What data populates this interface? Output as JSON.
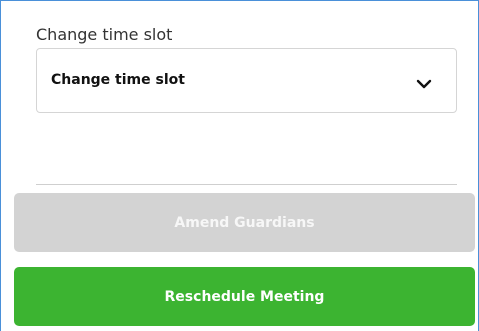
{
  "time_slot": {
    "label": "Change time slot",
    "selected_value": "Change time slot"
  },
  "actions": {
    "amend_label": "Amend Guardians",
    "amend_state": "disabled",
    "reschedule_label": "Reschedule Meeting"
  },
  "colors": {
    "frame_border": "#4a90d9",
    "disabled_button": "#d3d3d3",
    "primary_button": "#3cb431"
  },
  "icons": {
    "select_indicator": "chevron-down-icon"
  }
}
